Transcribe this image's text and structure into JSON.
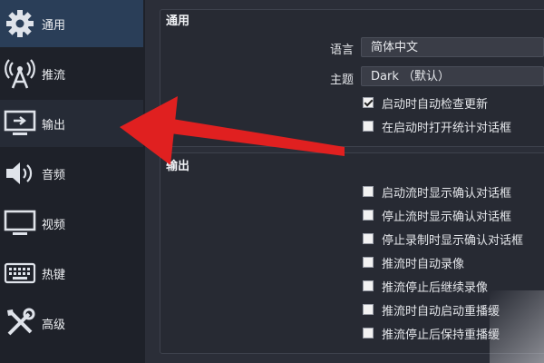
{
  "sidebar": {
    "items": [
      {
        "label": "通用",
        "icon": "gear-icon"
      },
      {
        "label": "推流",
        "icon": "broadcast-antenna-icon"
      },
      {
        "label": "输出",
        "icon": "monitor-output-icon"
      },
      {
        "label": "音频",
        "icon": "speaker-icon"
      },
      {
        "label": "视频",
        "icon": "monitor-icon"
      },
      {
        "label": "热键",
        "icon": "keyboard-icon"
      },
      {
        "label": "高级",
        "icon": "tools-icon"
      }
    ]
  },
  "general": {
    "title": "通用",
    "language_label": "语言",
    "language_value": "简体中文",
    "theme_label": "主题",
    "theme_value": "Dark （默认）",
    "check_updates": "启动时自动检查更新",
    "open_stats": "在启动时打开统计对话框"
  },
  "output": {
    "title": "输出",
    "items": [
      "启动流时显示确认对话框",
      "停止流时显示确认对话框",
      "停止录制时显示确认对话框",
      "推流时自动录像",
      "推流停止后继续录像",
      "推流时自动启动重播缓",
      "推流停止后保持重播缓"
    ]
  },
  "colors": {
    "accent": "#2a3e58",
    "arrow": "#e02020"
  }
}
